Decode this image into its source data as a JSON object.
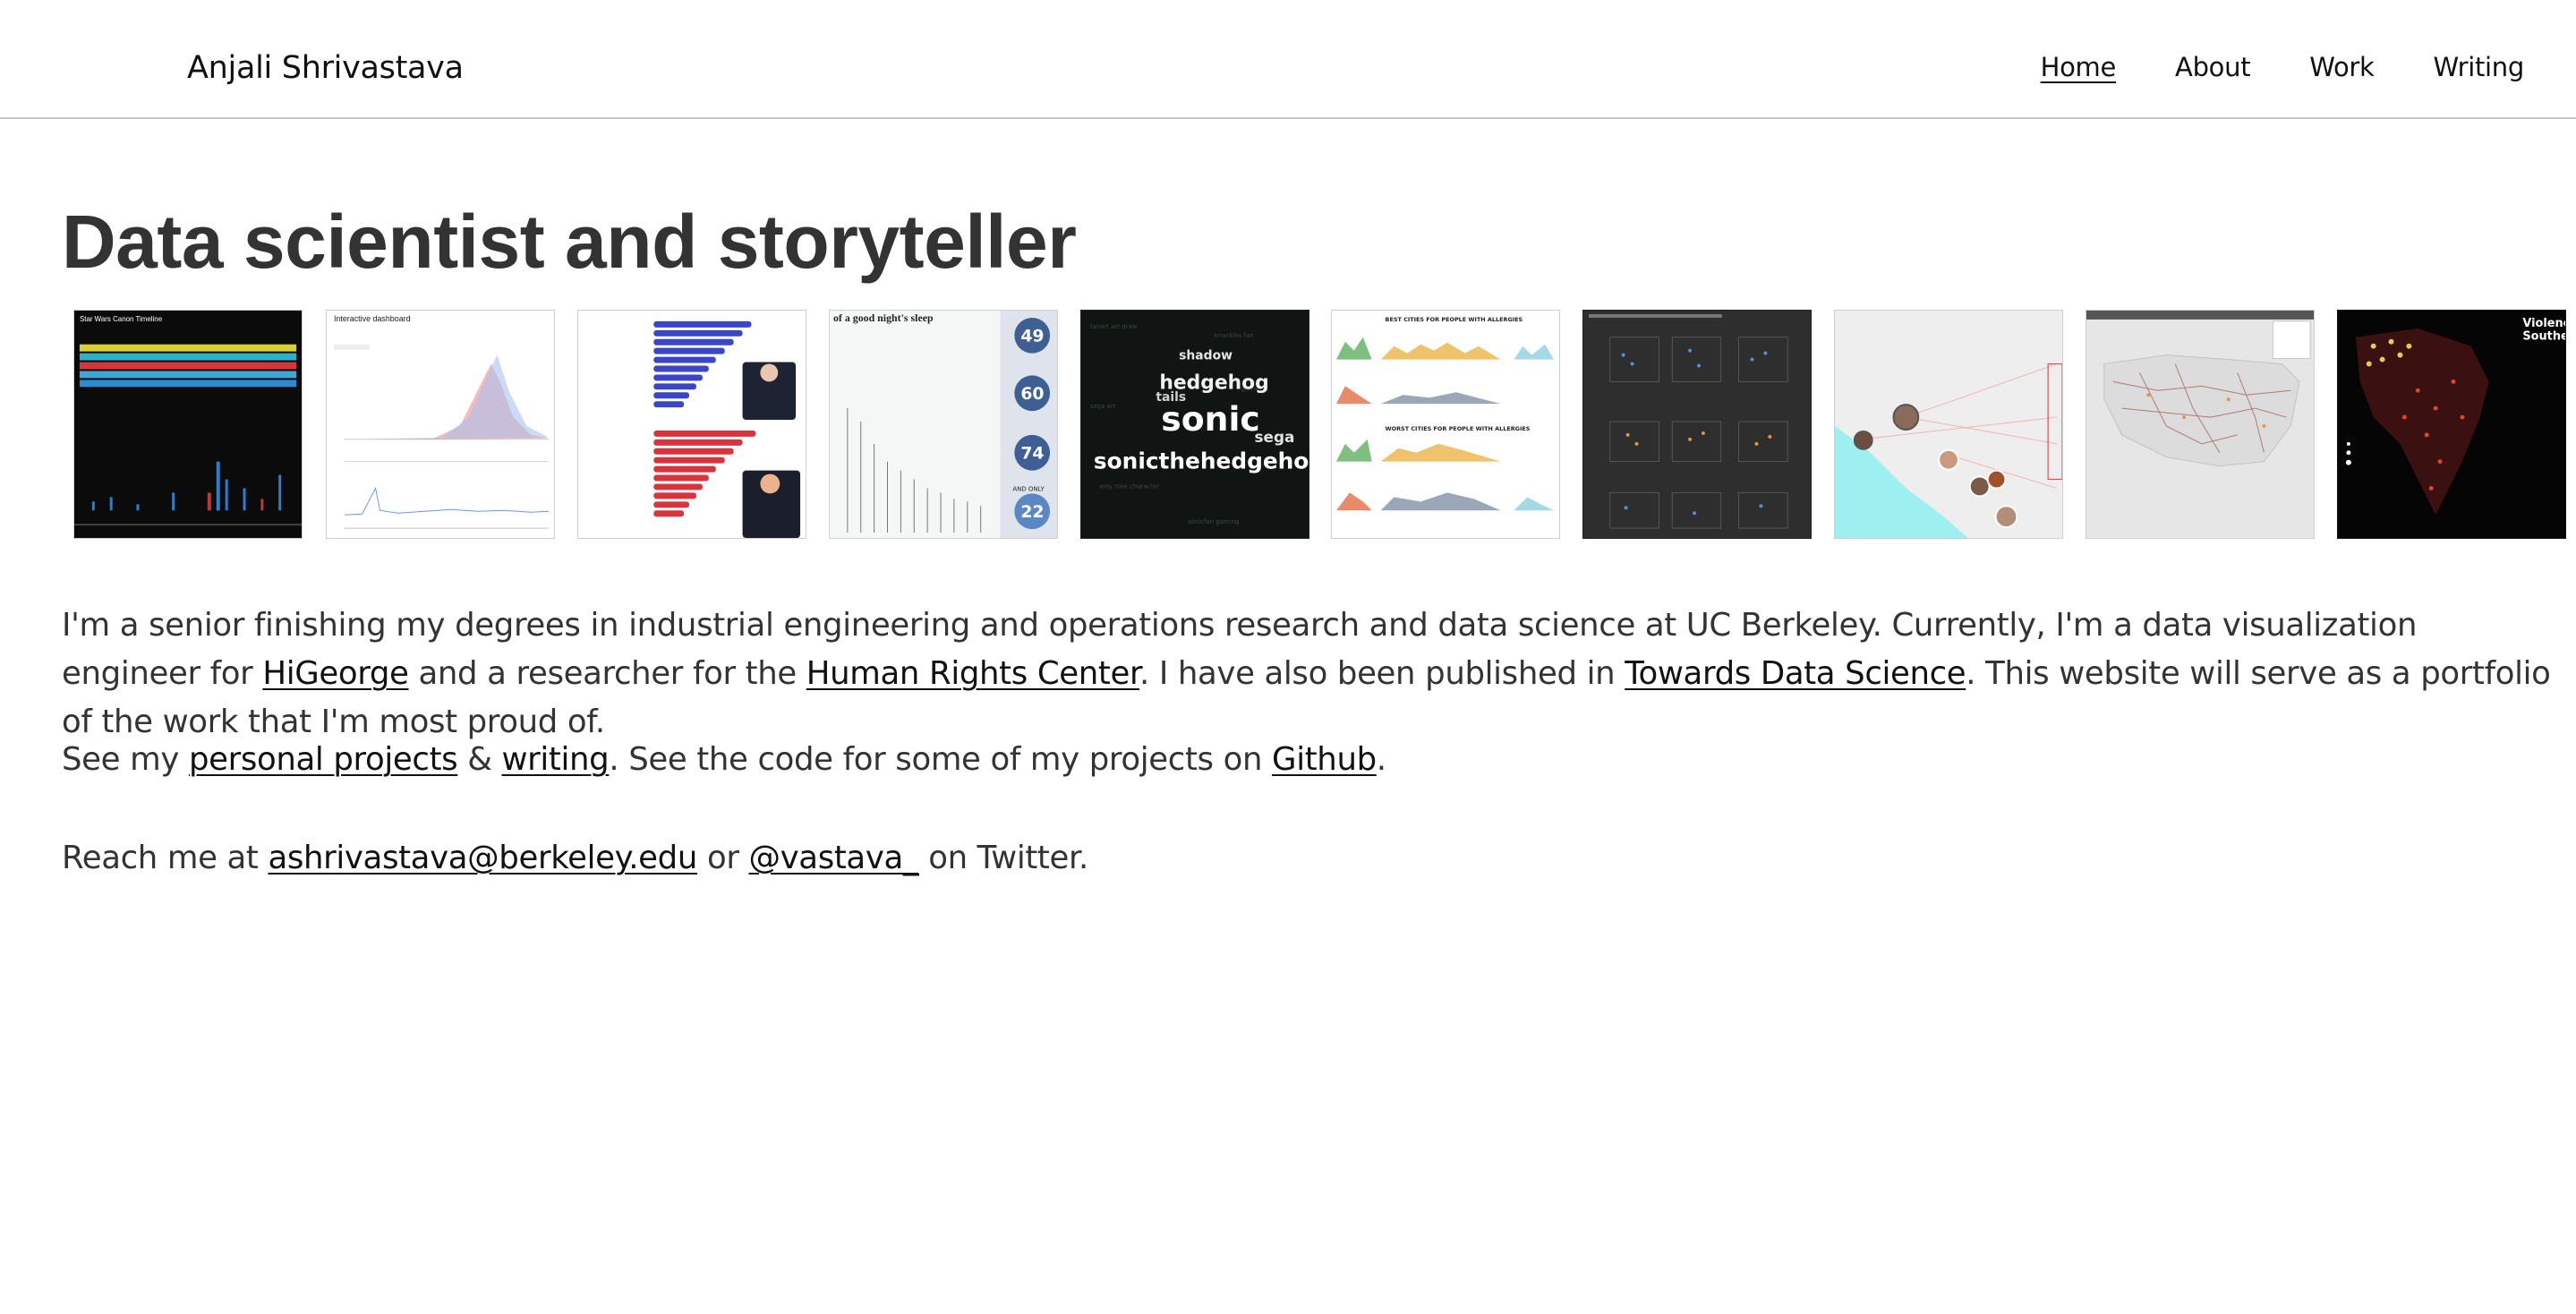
{
  "header": {
    "site_title": "Anjali Shrivastava",
    "nav": [
      {
        "label": "Home",
        "active": true
      },
      {
        "label": "About",
        "active": false
      },
      {
        "label": "Work",
        "active": false
      },
      {
        "label": "Writing",
        "active": false
      }
    ]
  },
  "main": {
    "headline": "Data scientist and storyteller",
    "thumbnails": [
      {
        "caption": "Star Wars Canon Timeline",
        "theme": "dark"
      },
      {
        "caption": "Interactive dashboard",
        "theme": "light"
      },
      {
        "caption": "",
        "theme": "light"
      },
      {
        "caption": "of a good night's sleep",
        "theme": "light"
      },
      {
        "caption": "sonic",
        "theme": "dark"
      },
      {
        "caption": "BEST CITIES FOR PEOPLE WITH ALLERGIES",
        "theme": "light"
      },
      {
        "caption": "",
        "theme": "dark"
      },
      {
        "caption": "",
        "theme": "map"
      },
      {
        "caption": "",
        "theme": "map"
      },
      {
        "caption": "Violence",
        "theme": "dark"
      }
    ],
    "thumb_words": {
      "hedgehog": "hedgehog",
      "sonic": "sonic",
      "sonicthehedgehog": "sonicthehedgeho",
      "sega": "sega",
      "shadow": "shadow",
      "tails": "tails",
      "sleep_numbers": [
        "49",
        "60",
        "74",
        "22"
      ],
      "and_only": "AND ONLY",
      "worst": "WORST CITIES FOR PEOPLE WITH ALLERGIES",
      "southeast": "Southea"
    },
    "intro": {
      "part1": "I'm a senior finishing my degrees in industrial engineering and operations research and data science at UC Berkeley. Currently, I'm a data visualization engineer for ",
      "link1": "HiGeorge",
      "part2": " and a researcher for the ",
      "link2": "Human Rights Center",
      "part3": ". I have also been published in ",
      "link3": "Towards Data Science",
      "part4": ". This website will serve as a portfolio of the work that I'm most proud of."
    },
    "projects": {
      "prefix": "See my ",
      "link_projects": "personal projects",
      "amp": " & ",
      "link_writing": "writing",
      "middle": ". See the code for some of my projects on ",
      "link_github": "Github",
      "suffix": "."
    },
    "contact": {
      "prefix": "Reach me at ",
      "email": "ashrivastava@berkeley.edu",
      "middle": " or ",
      "twitter": "@vastava_",
      "suffix": " on Twitter."
    }
  },
  "colors": {
    "text": "#333333",
    "link": "#111111",
    "divider": "#c6c6c6",
    "biden_blue": "#3b45c8",
    "trump_red": "#d8343d"
  }
}
